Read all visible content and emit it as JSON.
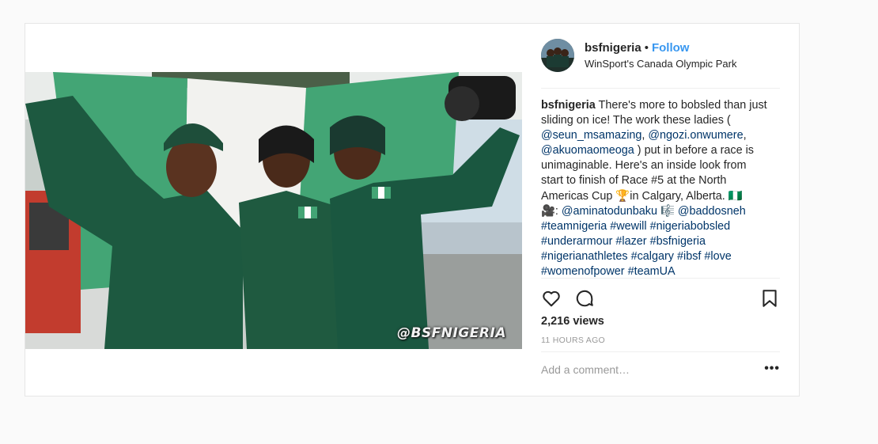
{
  "post": {
    "username": "bsfnigeria",
    "separator": "•",
    "follow_label": "Follow",
    "location": "WinSport's Canada Olympic Park",
    "watermark": "@BSFNIGERIA",
    "caption": {
      "line1": "There's more to bobsled than just",
      "line2": "sliding on ice! The work these ladies (",
      "mention1": "@seun_msamazing",
      "comma1": ",",
      "mention2": "@ngozi.onwumere",
      "comma2": ",",
      "mention3": "@akuomaomeoga",
      "line4_rest": " ) put in before a race is",
      "line5": "unimaginable. Here's an inside look from",
      "line6": "start to finish of Race #5 at the North",
      "line7a": "Americas Cup ",
      "trophy": "🏆",
      "line7b": "in Calgary, Alberta. ",
      "flag": "🇳🇬",
      "camera": "🎥",
      "colon": ": ",
      "mention4": "@aminatodunbaku",
      "music": "🎼",
      "mention5": "@baddosneh",
      "tags_line1": "#teamnigeria #wewill #nigeriabobsled",
      "tags_line2": "#underarmour #lazer #bsfnigeria",
      "tags_line3": "#nigerianathletes #calgary #ibsf #love",
      "tags_line4": "#womenofpower #teamUA"
    },
    "views": "2,216 views",
    "time": "11 HOURS AGO",
    "comment_placeholder": "Add a comment…",
    "more_label": "•••"
  },
  "icons": {
    "like": "heart-icon",
    "comment": "speech-bubble-icon",
    "save": "bookmark-icon"
  },
  "colors": {
    "accent": "#3897f0",
    "tag": "#003569",
    "suit_green": "#1f5a3f",
    "flag_green": "#3fa274"
  }
}
